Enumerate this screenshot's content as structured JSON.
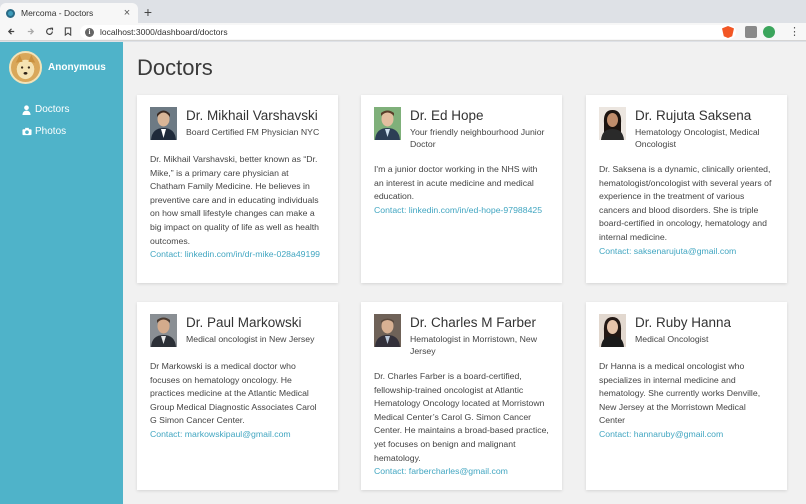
{
  "browser": {
    "tab_title": "Mercoma - Doctors",
    "url": "localhost:3000/dashboard/doctors"
  },
  "sidebar": {
    "username": "Anonymous",
    "items": [
      {
        "label": "Doctors",
        "icon": "user-icon"
      },
      {
        "label": "Photos",
        "icon": "camera-icon"
      }
    ]
  },
  "page": {
    "title": "Doctors"
  },
  "contact_prefix": "Contact: ",
  "doctors": [
    {
      "name": "Dr. Mikhail Varshavski",
      "title": "Board Certified FM Physician NYC",
      "bio": "Dr. Mikhail Varshavski, better known as “Dr. Mike,” is a primary care physician at Chatham Family Medicine. He believes in preventive care and in educating individuals on how small lifestyle changes can make a big impact on quality of life as well as health outcomes.",
      "contact": "linkedin.com/in/dr-mike-028a49199"
    },
    {
      "name": "Dr. Ed Hope",
      "title": "Your friendly neighbourhood Junior Doctor",
      "bio": "I'm a junior doctor working in the NHS with an interest in acute medicine and medical education.",
      "contact": "linkedin.com/in/ed-hope-97988425"
    },
    {
      "name": "Dr. Rujuta Saksena",
      "title": "Hematology Oncologist, Medical Oncologist",
      "bio": "Dr. Saksena is a dynamic, clinically oriented, hematologist/oncologist with several years of experience in the treatment of various cancers and blood disorders. She is triple board-certified in oncology, hematology and internal medicine.",
      "contact": "saksenarujuta@gmail.com"
    },
    {
      "name": "Dr. Paul Markowski",
      "title": "Medical oncologist in New Jersey",
      "bio": "Dr Markowski is a medical doctor who focuses on hematology oncology. He practices medicine at the Atlantic Medical Group Medical Diagnostic Associates Carol G Simon Cancer Center.",
      "contact": "markowskipaul@gmail.com"
    },
    {
      "name": "Dr. Charles M Farber",
      "title": "Hematologist in Morristown, New Jersey",
      "bio": "Dr. Charles Farber is a board-certified, fellowship-trained oncologist at Atlantic Hematology Oncology located at Morristown Medical Center’s Carol G. Simon Cancer Center. He maintains a broad-based practice, yet focuses on benign and malignant hematology.",
      "contact": "farbercharles@gmail.com"
    },
    {
      "name": "Dr. Ruby Hanna",
      "title": "Medical Oncologist",
      "bio": "Dr Hanna is a medical oncologist who specializes in internal medicine and hematology. She currently works Denville, New Jersey at the Morristown Medical Center",
      "contact": "hannaruby@gmail.com"
    }
  ],
  "colors": {
    "sidebar": "#4fb3c9",
    "link": "#42a6c1",
    "background": "#f1f1f1"
  }
}
